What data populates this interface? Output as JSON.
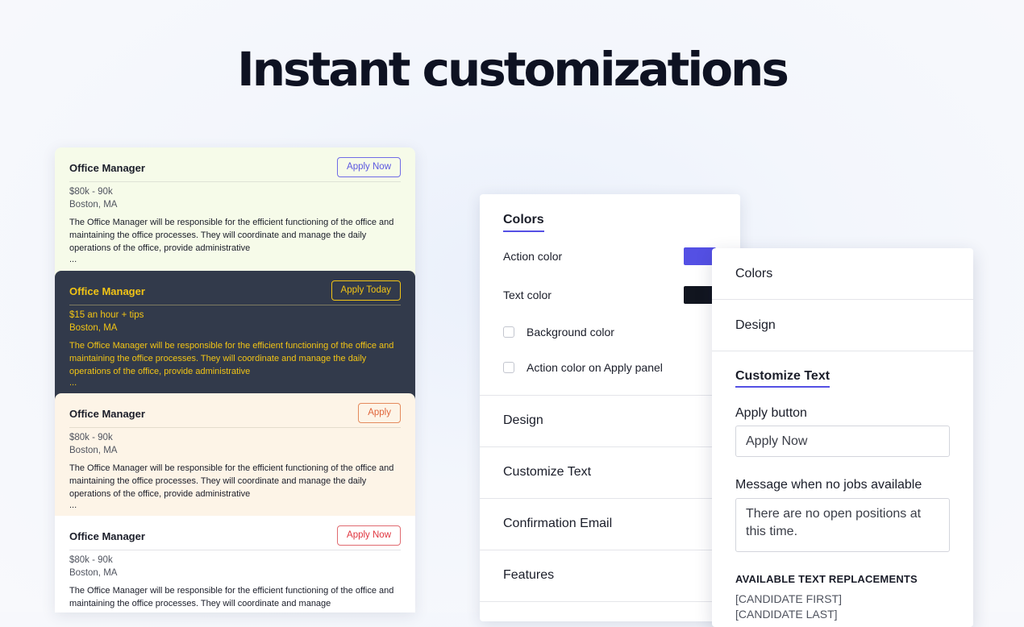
{
  "headline": "Instant customizations",
  "cards": [
    {
      "title": "Office Manager",
      "button": "Apply Now",
      "salary": "$80k - 90k",
      "location": "Boston, MA",
      "description": "The Office Manager will be responsible for the efficient functioning of the office and maintaining the office processes. They will coordinate and manage the daily operations of the office, provide administrative",
      "ellipsis": "..."
    },
    {
      "title": "Office Manager",
      "button": "Apply Today",
      "salary": "$15 an hour + tips",
      "location": "Boston, MA",
      "description": "The Office Manager will be responsible for the efficient functioning of the office and maintaining the office processes. They will coordinate and manage the daily operations of the office, provide administrative",
      "ellipsis": "..."
    },
    {
      "title": "Office Manager",
      "button": "Apply",
      "salary": "$80k - 90k",
      "location": "Boston, MA",
      "description": "The Office Manager will be responsible for the efficient functioning of the office and maintaining the office processes. They will coordinate and manage the daily operations of the office, provide administrative",
      "ellipsis": "..."
    },
    {
      "title": "Office Manager",
      "button": "Apply Now",
      "salary": "$80k - 90k",
      "location": "Boston, MA",
      "description": "The Office Manager will be responsible for the efficient functioning of the office and maintaining the office processes. They will coordinate and manage"
    }
  ],
  "colors_panel": {
    "title": "Colors",
    "action_color_label": "Action color",
    "action_color": "#5450e4",
    "text_color_label": "Text color",
    "text_color": "#11151f",
    "background_color_label": "Background color",
    "apply_panel_color_label": "Action color on Apply panel",
    "sections": [
      "Design",
      "Customize Text",
      "Confirmation Email",
      "Features"
    ]
  },
  "text_panel": {
    "sections": [
      "Colors",
      "Design"
    ],
    "title": "Customize Text",
    "apply_button_label": "Apply button",
    "apply_button_value": "Apply Now",
    "no_jobs_label": "Message when no jobs available",
    "no_jobs_value": "There are no open positions at this time.",
    "replacements_title": "AVAILABLE TEXT REPLACEMENTS",
    "replacements": [
      "[CANDIDATE FIRST]",
      "[CANDIDATE LAST]"
    ]
  }
}
